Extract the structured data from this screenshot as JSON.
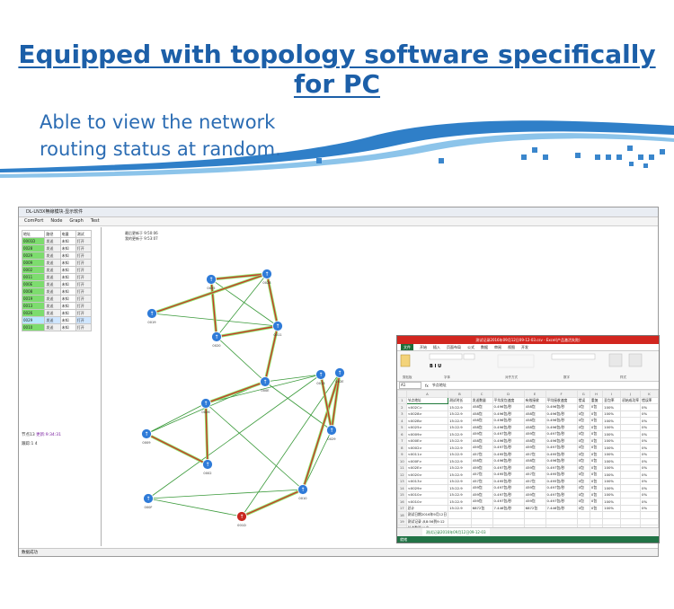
{
  "headline": "Equipped with topology software specifically for PC",
  "subline": [
    "Able to view the network",
    "routing status at random."
  ],
  "app": {
    "title": "DL-LN3X無線模块·显示软件",
    "menu": [
      "ComPort",
      "Node",
      "Graph",
      "Test"
    ],
    "table_header": [
      "地址",
      "路径",
      "电量",
      "测试"
    ],
    "rows": [
      {
        "addr": "0001D",
        "path": "发送",
        "power": "未知",
        "test": "打开"
      },
      {
        "addr": "0028",
        "path": "发送",
        "power": "未知",
        "test": "打开"
      },
      {
        "addr": "0029",
        "path": "发送",
        "power": "未知",
        "test": "打开"
      },
      {
        "addr": "0009",
        "path": "发送",
        "power": "未知",
        "test": "打开"
      },
      {
        "addr": "0002",
        "path": "发送",
        "power": "未知",
        "test": "打开"
      },
      {
        "addr": "0011",
        "path": "发送",
        "power": "未知",
        "test": "打开"
      },
      {
        "addr": "000E",
        "path": "发送",
        "power": "未知",
        "test": "打开"
      },
      {
        "addr": "0008",
        "path": "发送",
        "power": "未知",
        "test": "打开"
      },
      {
        "addr": "0019",
        "path": "发送",
        "power": "未知",
        "test": "打开"
      },
      {
        "addr": "0013",
        "path": "发送",
        "power": "未知",
        "test": "打开"
      },
      {
        "addr": "0026",
        "path": "发送",
        "power": "未知",
        "test": "打开"
      },
      {
        "addr": "0029",
        "path": "发送",
        "power": "未知",
        "test": "打开"
      },
      {
        "addr": "0010",
        "path": "发送",
        "power": "未知",
        "test": "打开"
      }
    ],
    "left_status1": "节点13",
    "left_status1_b": "更新:9:34:31",
    "left_status2": "跟踪:1 4",
    "info_line1": "最后更新于 9:50:06",
    "info_line2": "我的更新于 9:53:07",
    "statusbar": "数据成功"
  },
  "excel": {
    "title": "测试记录2016年09月12日09-12-03.csv - Excel(产品激活失败)",
    "tabs": [
      "文件",
      "开始",
      "插入",
      "页面布局",
      "公式",
      "数据",
      "审阅",
      "视图",
      "开发"
    ],
    "ribbon_groups": [
      "剪贴板",
      "字体",
      "对齐方式",
      "数字",
      "样式"
    ],
    "cell_ref": "A1",
    "formula": "节点地址",
    "col_letters": [
      "A",
      "B",
      "C",
      "D",
      "E",
      "F",
      "G",
      "H",
      "I",
      "J",
      "K"
    ],
    "header": [
      "节点地址",
      "测试时长",
      "发送数量",
      "平均发包速度",
      "有效接收",
      "平均接收速度",
      "错误",
      "重复",
      "丢包率",
      "初始成功率",
      "错误率"
    ],
    "rows": [
      [
        "<002C>",
        "15:22.9",
        "458包",
        "0.496包/秒",
        "458包",
        "0.496包/秒",
        "0包",
        "0包",
        "100%",
        "",
        "0%"
      ],
      [
        "<0028>",
        "15:22.9",
        "458包",
        "0.496包/秒",
        "458包",
        "0.496包/秒",
        "0包",
        "0包",
        "100%",
        "",
        "0%"
      ],
      [
        "<002B>",
        "15:22.9",
        "458包",
        "0.496包/秒",
        "458包",
        "0.496包/秒",
        "0包",
        "0包",
        "100%",
        "",
        "0%"
      ],
      [
        "<0025>",
        "15:22.9",
        "458包",
        "0.496包/秒",
        "458包",
        "0.496包/秒",
        "0包",
        "0包",
        "100%",
        "",
        "0%"
      ],
      [
        "<0009>",
        "15:22.9",
        "459包",
        "0.497包/秒",
        "459包",
        "0.497包/秒",
        "0包",
        "0包",
        "100%",
        "",
        "0%"
      ],
      [
        "<000E>",
        "15:22.9",
        "458包",
        "0.496包/秒",
        "458包",
        "0.496包/秒",
        "0包",
        "0包",
        "100%",
        "",
        "0%"
      ],
      [
        "<0002>",
        "15:22.9",
        "459包",
        "0.497包/秒",
        "459包",
        "0.497包/秒",
        "0包",
        "0包",
        "100%",
        "",
        "0%"
      ],
      [
        "<0011>",
        "15:22.9",
        "457包",
        "0.495包/秒",
        "457包",
        "0.495包/秒",
        "0包",
        "0包",
        "100%",
        "",
        "0%"
      ],
      [
        "<000F>",
        "15:22.9",
        "458包",
        "0.496包/秒",
        "458包",
        "0.496包/秒",
        "0包",
        "0包",
        "100%",
        "",
        "0%"
      ],
      [
        "<002E>",
        "15:22.9",
        "459包",
        "0.497包/秒",
        "459包",
        "0.497包/秒",
        "0包",
        "0包",
        "100%",
        "",
        "0%"
      ],
      [
        "<0020>",
        "15:22.9",
        "457包",
        "0.495包/秒",
        "457包",
        "0.495包/秒",
        "0包",
        "0包",
        "100%",
        "",
        "0%"
      ],
      [
        "<0013>",
        "15:22.9",
        "457包",
        "0.495包/秒",
        "457包",
        "0.495包/秒",
        "0包",
        "0包",
        "100%",
        "",
        "0%"
      ],
      [
        "<0029>",
        "15:22.9",
        "459包",
        "0.497包/秒",
        "459包",
        "0.497包/秒",
        "0包",
        "0包",
        "100%",
        "",
        "0%"
      ],
      [
        "<0010>",
        "15:22.9",
        "459包",
        "0.497包/秒",
        "459包",
        "0.497包/秒",
        "0包",
        "0包",
        "100%",
        "",
        "0%"
      ],
      [
        "<0010>",
        "15:22.9",
        "459包",
        "0.497包/秒",
        "459包",
        "0.497包/秒",
        "0包",
        "0包",
        "100%",
        "",
        "0%"
      ],
      [
        "总计",
        "15:22.9",
        "6872包",
        "7.446包/秒",
        "6872包",
        "7.446包/秒",
        "0包",
        "0包",
        "100%",
        "",
        "0%"
      ],
      [
        "测试日期2016年9月12日",
        "",
        "",
        "",
        "",
        "",
        "",
        "",
        "",
        "",
        ""
      ],
      [
        "测试记录 从8:56到9:12",
        "",
        "",
        "",
        "",
        "",
        "",
        "",
        "",
        "",
        ""
      ],
      [
        "节点数量15个",
        "",
        "",
        "",
        "",
        "",
        "",
        "",
        "",
        "",
        ""
      ]
    ],
    "sheet_tab": "测试记录2016年09月12日09-12-03",
    "status": "就绪"
  },
  "topology": {
    "nodes": [
      {
        "id": "n1",
        "label": "0025"
      },
      {
        "id": "n2",
        "label": "0028"
      },
      {
        "id": "n3",
        "label": "0019"
      },
      {
        "id": "n4",
        "label": "0020"
      },
      {
        "id": "n5",
        "label": "0011"
      },
      {
        "id": "n6",
        "label": "0013"
      },
      {
        "id": "n7",
        "label": "000E"
      },
      {
        "id": "n8",
        "label": "0029"
      },
      {
        "id": "n9",
        "label": "0026"
      },
      {
        "id": "n10",
        "label": "0009"
      },
      {
        "id": "n11",
        "label": "0002"
      },
      {
        "id": "n12",
        "label": "0010"
      },
      {
        "id": "n13",
        "label": "002E"
      },
      {
        "id": "n14",
        "label": "000F"
      },
      {
        "id": "n15",
        "label": "001D"
      }
    ],
    "active_edges": [
      [
        "n1",
        "n2"
      ],
      [
        "n1",
        "n4"
      ],
      [
        "n2",
        "n3"
      ],
      [
        "n2",
        "n5"
      ],
      [
        "n5",
        "n7"
      ],
      [
        "n7",
        "n9"
      ],
      [
        "n9",
        "n11"
      ],
      [
        "n11",
        "n10"
      ],
      [
        "n13",
        "n12"
      ],
      [
        "n12",
        "n15"
      ],
      [
        "n6",
        "n8"
      ],
      [
        "n8",
        "n13"
      ],
      [
        "n5",
        "n4"
      ]
    ],
    "other_edges": [
      [
        "n1",
        "n5"
      ],
      [
        "n4",
        "n7"
      ],
      [
        "n7",
        "n6"
      ],
      [
        "n7",
        "n8"
      ],
      [
        "n6",
        "n9"
      ],
      [
        "n9",
        "n12"
      ],
      [
        "n12",
        "n14"
      ],
      [
        "n14",
        "n15"
      ],
      [
        "n13",
        "n15"
      ],
      [
        "n8",
        "n12"
      ],
      [
        "n6",
        "n14"
      ],
      [
        "n3",
        "n5"
      ],
      [
        "n7",
        "n10"
      ],
      [
        "n9",
        "n10"
      ],
      [
        "n2",
        "n4"
      ]
    ]
  }
}
